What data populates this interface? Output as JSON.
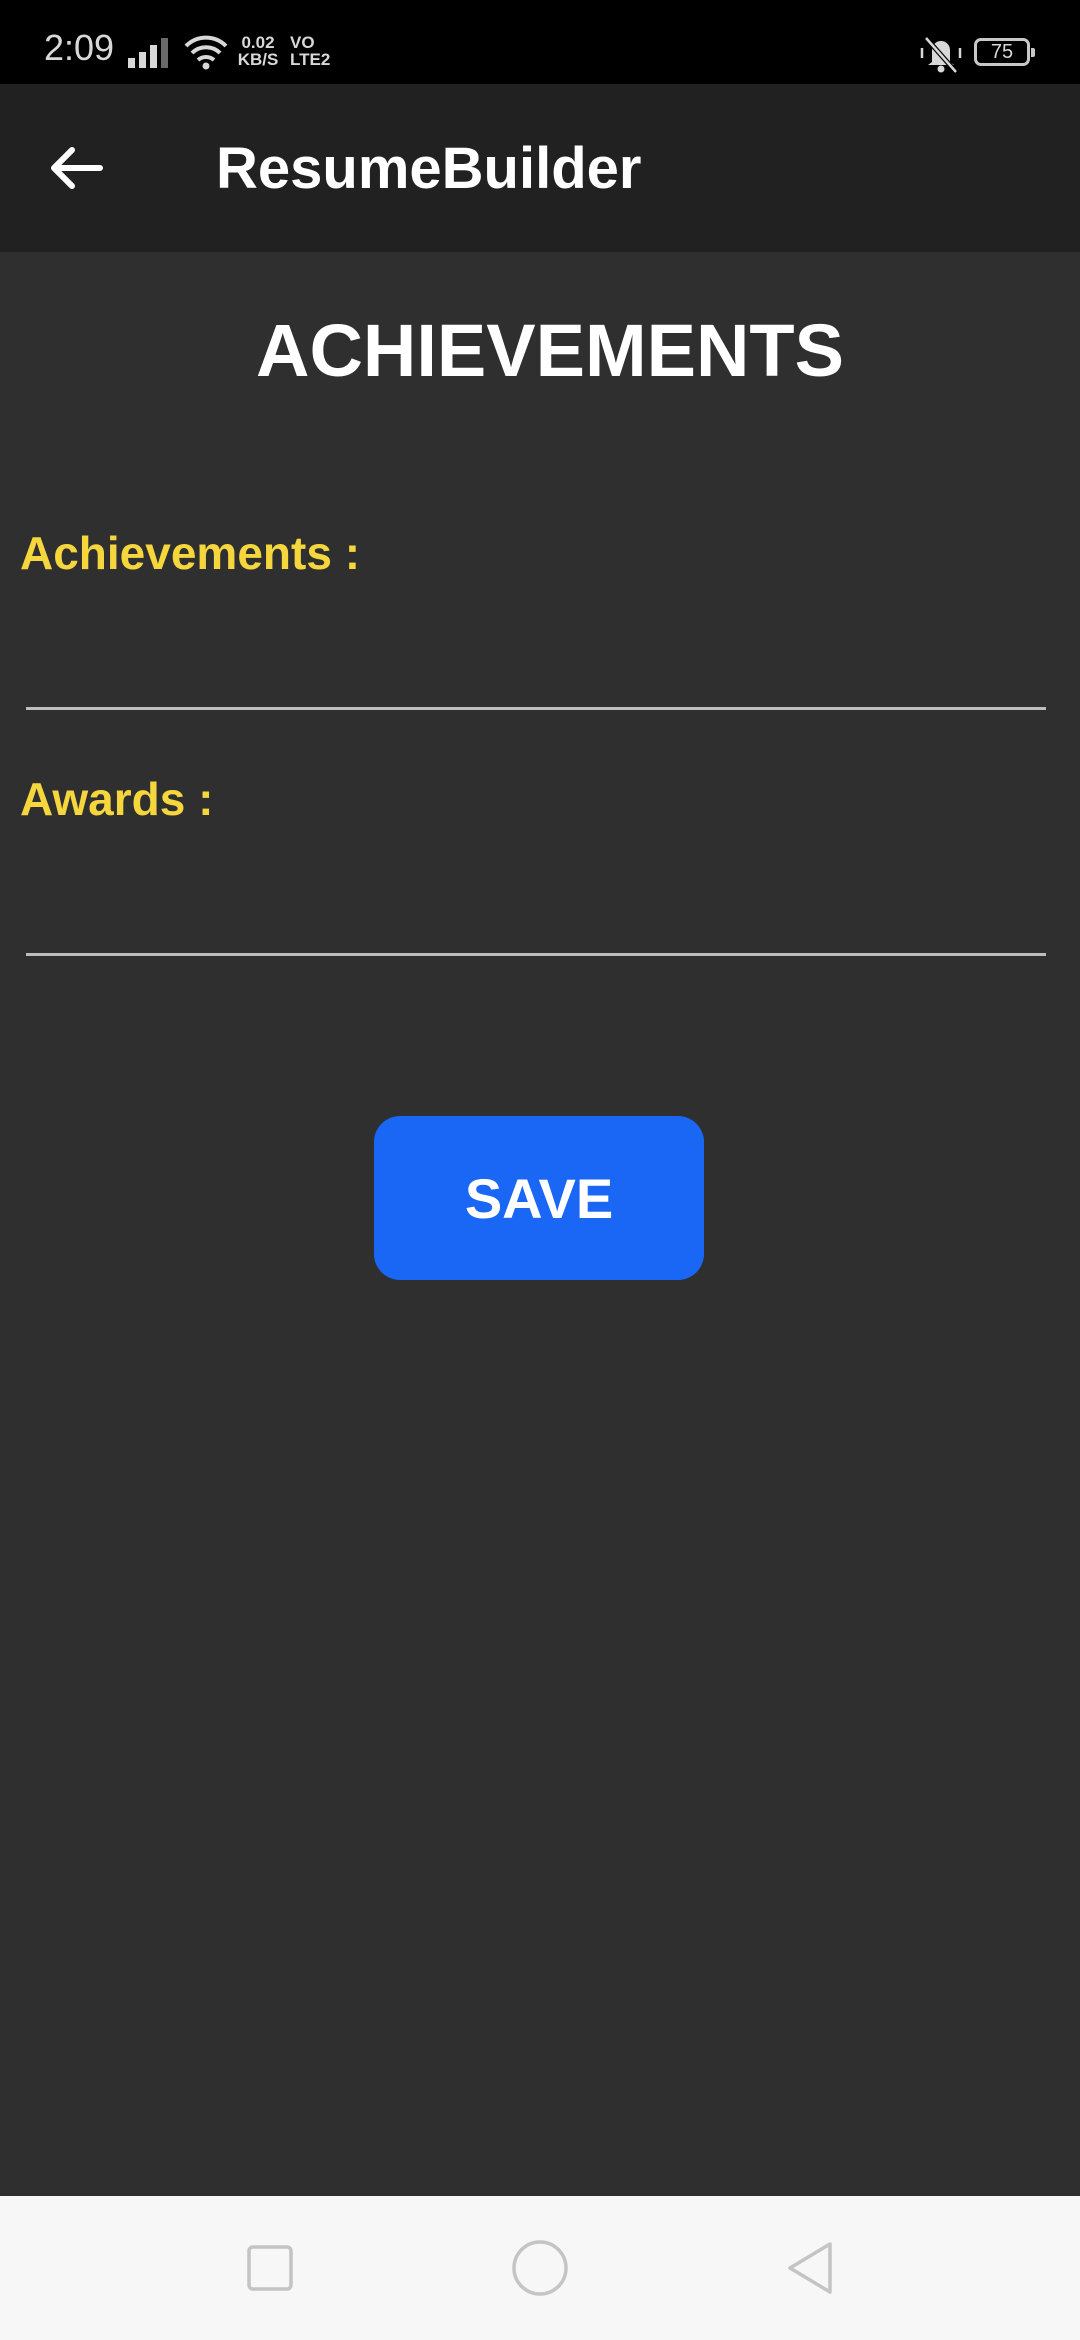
{
  "status_bar": {
    "time": "2:09",
    "net_speed_value": "0.02",
    "net_speed_unit": "KB/S",
    "volte_top": "VO",
    "volte_bottom": "LTE2",
    "battery": "75"
  },
  "app_bar": {
    "title": "ResumeBuilder",
    "back_icon": "arrow-left-icon"
  },
  "page": {
    "heading": "ACHIEVEMENTS",
    "fields": [
      {
        "label": "Achievements :",
        "value": ""
      },
      {
        "label": "Awards :",
        "value": ""
      }
    ],
    "save_label": "SAVE"
  },
  "nav_bar": {
    "recents_icon": "square-icon",
    "home_icon": "circle-icon",
    "back_icon": "triangle-back-icon"
  },
  "colors": {
    "background": "#2f2f2f",
    "app_bar": "#212121",
    "label": "#f5d63d",
    "button": "#1a66f5"
  }
}
